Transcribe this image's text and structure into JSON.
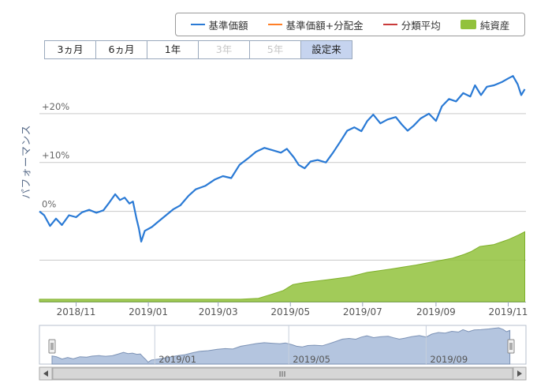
{
  "legend": {
    "items": [
      {
        "label": "基準価額",
        "color": "#2a7ad5",
        "style": "line"
      },
      {
        "label": "基準価額+分配金",
        "color": "#ff7f27",
        "style": "line"
      },
      {
        "label": "分類平均",
        "color": "#c93a3a",
        "style": "line"
      },
      {
        "label": "純資産",
        "color": "#92c23c",
        "style": "area"
      }
    ]
  },
  "range_selector": {
    "buttons": [
      {
        "label": "3ヵ月",
        "state": "normal"
      },
      {
        "label": "6ヵ月",
        "state": "normal"
      },
      {
        "label": "1年",
        "state": "normal"
      },
      {
        "label": "3年",
        "state": "disabled"
      },
      {
        "label": "5年",
        "state": "disabled"
      },
      {
        "label": "設定来",
        "state": "active"
      }
    ]
  },
  "navigator": {
    "labels": [
      "2019/01",
      "2019/05",
      "2019/09"
    ],
    "scroll_grip": "III"
  },
  "chart_data": {
    "type": "line",
    "ylabel": "パフォーマンス",
    "ylim": [
      -18.5,
      30
    ],
    "xlim": [
      "2018-10-01",
      "2019-11-16"
    ],
    "y_ticks": [
      {
        "value": 20,
        "label": "+20%"
      },
      {
        "value": 10,
        "label": "+10%"
      },
      {
        "value": 0,
        "label": "0%"
      },
      {
        "value": -10,
        "label": ""
      }
    ],
    "x_ticks": [
      {
        "date": "2018-11-01",
        "label": "2018/11"
      },
      {
        "date": "2019-01-01",
        "label": "2019/01"
      },
      {
        "date": "2019-03-01",
        "label": "2019/03"
      },
      {
        "date": "2019-05-01",
        "label": "2019/05"
      },
      {
        "date": "2019-07-01",
        "label": "2019/07"
      },
      {
        "date": "2019-09-01",
        "label": "2019/09"
      },
      {
        "date": "2019-11-01",
        "label": "2019/11"
      }
    ],
    "grid": true,
    "series": [
      {
        "name": "基準価額",
        "color": "#2a7ad5",
        "points": [
          [
            "2018-10-01",
            0.0
          ],
          [
            "2018-10-05",
            -0.8
          ],
          [
            "2018-10-10",
            -3.0
          ],
          [
            "2018-10-15",
            -1.5
          ],
          [
            "2018-10-20",
            -2.8
          ],
          [
            "2018-10-26",
            -0.8
          ],
          [
            "2018-11-01",
            -1.2
          ],
          [
            "2018-11-06",
            -0.2
          ],
          [
            "2018-11-12",
            0.3
          ],
          [
            "2018-11-18",
            -0.3
          ],
          [
            "2018-11-24",
            0.2
          ],
          [
            "2018-11-29",
            1.8
          ],
          [
            "2018-12-04",
            3.5
          ],
          [
            "2018-12-08",
            2.3
          ],
          [
            "2018-12-12",
            2.8
          ],
          [
            "2018-12-16",
            1.6
          ],
          [
            "2018-12-19",
            2.0
          ],
          [
            "2018-12-22",
            -1.5
          ],
          [
            "2018-12-24",
            -3.5
          ],
          [
            "2018-12-26",
            -6.2
          ],
          [
            "2018-12-29",
            -4.0
          ],
          [
            "2019-01-04",
            -3.2
          ],
          [
            "2019-01-10",
            -2.0
          ],
          [
            "2019-01-16",
            -0.8
          ],
          [
            "2019-01-22",
            0.4
          ],
          [
            "2019-01-28",
            1.2
          ],
          [
            "2019-02-04",
            3.2
          ],
          [
            "2019-02-10",
            4.5
          ],
          [
            "2019-02-18",
            5.2
          ],
          [
            "2019-02-26",
            6.5
          ],
          [
            "2019-03-05",
            7.2
          ],
          [
            "2019-03-12",
            6.8
          ],
          [
            "2019-03-19",
            9.5
          ],
          [
            "2019-03-26",
            10.8
          ],
          [
            "2019-04-02",
            12.2
          ],
          [
            "2019-04-09",
            13.0
          ],
          [
            "2019-04-16",
            12.5
          ],
          [
            "2019-04-23",
            12.0
          ],
          [
            "2019-04-28",
            12.8
          ],
          [
            "2019-05-04",
            11.0
          ],
          [
            "2019-05-08",
            9.5
          ],
          [
            "2019-05-13",
            8.8
          ],
          [
            "2019-05-18",
            10.2
          ],
          [
            "2019-05-24",
            10.5
          ],
          [
            "2019-05-31",
            10.0
          ],
          [
            "2019-06-06",
            12.0
          ],
          [
            "2019-06-12",
            14.2
          ],
          [
            "2019-06-18",
            16.5
          ],
          [
            "2019-06-24",
            17.2
          ],
          [
            "2019-06-30",
            16.4
          ],
          [
            "2019-07-05",
            18.5
          ],
          [
            "2019-07-10",
            19.8
          ],
          [
            "2019-07-16",
            18.0
          ],
          [
            "2019-07-22",
            18.8
          ],
          [
            "2019-07-29",
            19.3
          ],
          [
            "2019-08-03",
            17.8
          ],
          [
            "2019-08-08",
            16.5
          ],
          [
            "2019-08-13",
            17.5
          ],
          [
            "2019-08-19",
            19.0
          ],
          [
            "2019-08-26",
            20.0
          ],
          [
            "2019-09-01",
            18.5
          ],
          [
            "2019-09-06",
            21.5
          ],
          [
            "2019-09-12",
            23.0
          ],
          [
            "2019-09-18",
            22.5
          ],
          [
            "2019-09-24",
            24.2
          ],
          [
            "2019-09-30",
            23.5
          ],
          [
            "2019-10-04",
            25.8
          ],
          [
            "2019-10-09",
            23.8
          ],
          [
            "2019-10-14",
            25.5
          ],
          [
            "2019-10-20",
            25.8
          ],
          [
            "2019-10-27",
            26.5
          ],
          [
            "2019-11-01",
            27.2
          ],
          [
            "2019-11-05",
            27.7
          ],
          [
            "2019-11-09",
            26.0
          ],
          [
            "2019-11-12",
            23.8
          ],
          [
            "2019-11-15",
            25.0
          ]
        ]
      },
      {
        "name": "純資産",
        "color": "#92c23c",
        "area": true,
        "points": [
          [
            "2018-10-01",
            -18.0
          ],
          [
            "2019-03-20",
            -18.0
          ],
          [
            "2019-04-04",
            -17.8
          ],
          [
            "2019-04-15",
            -17.0
          ],
          [
            "2019-04-25",
            -16.2
          ],
          [
            "2019-05-03",
            -15.0
          ],
          [
            "2019-05-12",
            -14.6
          ],
          [
            "2019-06-01",
            -14.0
          ],
          [
            "2019-06-20",
            -13.4
          ],
          [
            "2019-07-05",
            -12.5
          ],
          [
            "2019-07-25",
            -11.8
          ],
          [
            "2019-08-15",
            -11.0
          ],
          [
            "2019-09-01",
            -10.2
          ],
          [
            "2019-09-15",
            -9.6
          ],
          [
            "2019-09-25",
            -8.8
          ],
          [
            "2019-10-01",
            -8.2
          ],
          [
            "2019-10-08",
            -7.2
          ],
          [
            "2019-10-20",
            -6.8
          ],
          [
            "2019-11-01",
            -5.8
          ],
          [
            "2019-11-10",
            -4.8
          ],
          [
            "2019-11-15",
            -4.2
          ]
        ]
      }
    ]
  }
}
